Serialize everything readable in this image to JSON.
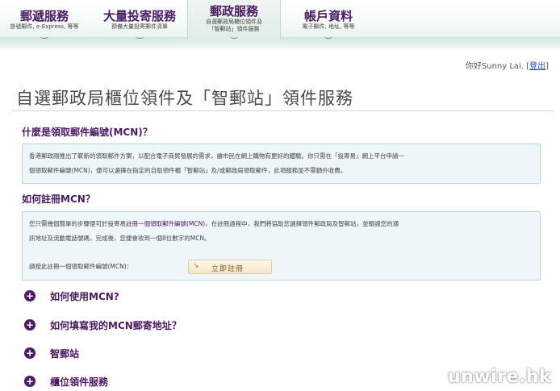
{
  "nav": {
    "items": [
      {
        "title": "郵遞服務",
        "sub": "掛號郵件, e-Express, 等等"
      },
      {
        "title": "大量投寄服務",
        "sub": "預備大量投寄郵件清單"
      },
      {
        "title": "郵政服務",
        "sub1": "自選郵政局櫃位領件及",
        "sub2": "「智郵站」領件服務"
      },
      {
        "title": "帳戶資料",
        "sub": "電子郵件, 地址, 等等"
      }
    ]
  },
  "greeting": {
    "text": "你好Sunny Lai. [",
    "logout": "登出",
    "close": "]"
  },
  "page_title": "自選郵政局櫃位領件及「智郵站」領件服務",
  "section1": {
    "title": "什麼是領取郵件編號(MCN)？",
    "line1": "香港郵政剛推出了嶄新的領取郵件方案，以配合電子商貿發展的需求，讓市民在網上購物有更好的體驗。你只需在「投寄易」網上平台申請一",
    "line2": "個領取郵件編號(MCN)，便可以選擇在指定的自助領件櫃「智郵站」及/或郵政局領取郵件，此項服務並不需額外收費。"
  },
  "section2": {
    "title": "如何註冊MCN？",
    "line1_a": "您只需幾個簡單的步驟便可於投寄易",
    "line1_link": "註冊一個領取郵件編號(MCN)",
    "line1_b": "，在註冊過程中，我們將協助您選擇領件郵政局及智郵站，並驗證您的通",
    "line2": "訊地址及流動電話號碼，完成後，您便會收到一個8位數字的MCN。",
    "prompt": "請按此註冊一個領取郵件編號(MCN)：",
    "button_arrow": "↘",
    "button": "立即註冊"
  },
  "accordion": [
    {
      "label": "如何使用MCN?"
    },
    {
      "label": "如何填寫我的MCN郵寄地址？"
    },
    {
      "label": "智郵站"
    },
    {
      "label": "櫃位領件服務"
    }
  ],
  "watermark": "unwire.hk"
}
